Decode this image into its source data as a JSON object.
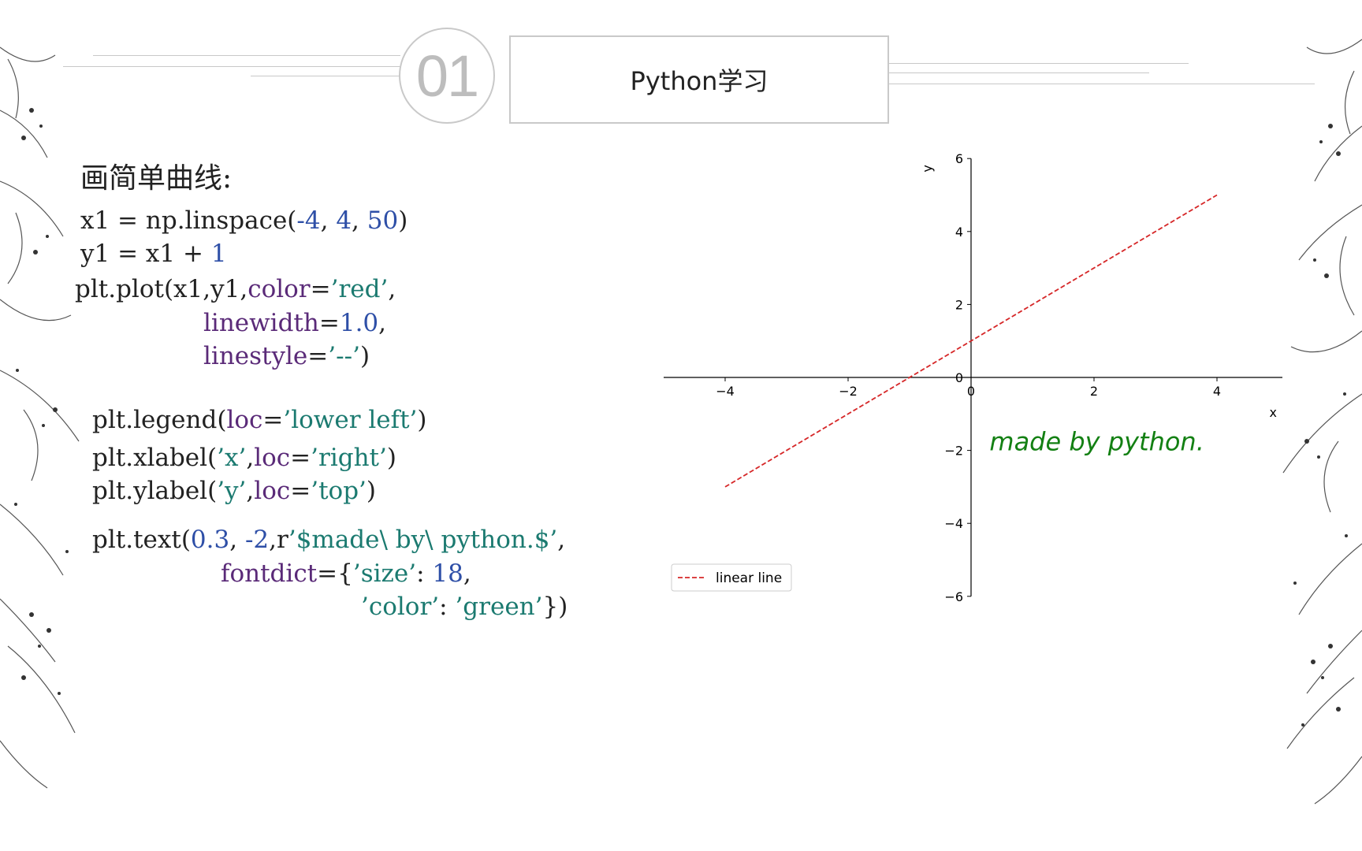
{
  "slide": {
    "section_number": "01",
    "title": "Python学习",
    "subtitle": "画简单曲线:"
  },
  "code": {
    "line1": {
      "a": "x1 = np.linspace(",
      "b": "-4",
      "c": ", ",
      "d": "4",
      "e": ", ",
      "f": "50",
      "g": ")"
    },
    "line2": {
      "a": "y1 = x1 + ",
      "b": "1"
    },
    "line3": {
      "a": "plt.plot(x1,y1,",
      "b": "color",
      "c": "=",
      "d": "’red’",
      "e": ","
    },
    "line4": {
      "a": "linewidth",
      "b": "=",
      "c": "1.0",
      "d": ","
    },
    "line5": {
      "a": "linestyle",
      "b": "=",
      "c": "’--’",
      "d": ")"
    },
    "line6": {
      "a": "plt.legend(",
      "b": "loc",
      "c": "=",
      "d": "’lower left’",
      "e": ")"
    },
    "line7": {
      "a": "plt.xlabel(",
      "b": "’x’",
      "c": ",",
      "d": "loc",
      "e": "=",
      "f": "’right’",
      "g": ")"
    },
    "line8": {
      "a": "plt.ylabel(",
      "b": "’y’",
      "c": ",",
      "d": "loc",
      "e": "=",
      "f": "’top’",
      "g": ")"
    },
    "line9": {
      "a": "plt.text(",
      "b": "0.3",
      "c": ", ",
      "d": "-2",
      "e": ",r",
      "f": "’$made\\ by\\ python.$’",
      "g": ","
    },
    "line10": {
      "a": "fontdict",
      "b": "={",
      "c": "’size’",
      "d": ": ",
      "e": "18",
      "f": ","
    },
    "line11": {
      "a": "’color’",
      "b": ": ",
      "c": "’green’",
      "d": "})"
    }
  },
  "colors": {
    "line": "#d62728",
    "annotation": "#138013",
    "code_number": "#2e4fa7",
    "code_keyword": "#5a2a78",
    "code_string": "#1b7a70"
  },
  "chart_data": {
    "type": "line",
    "x": [
      -4,
      4
    ],
    "series": [
      {
        "name": "linear line",
        "x": [
          -4,
          4
        ],
        "y": [
          -3,
          5
        ],
        "color": "#d62728",
        "linestyle": "dashed"
      }
    ],
    "xlabel": "x",
    "ylabel": "y",
    "xlim": [
      -5,
      5
    ],
    "ylim": [
      -6,
      6
    ],
    "xticks": [
      -4,
      -2,
      0,
      2,
      4
    ],
    "yticks": [
      -6,
      -4,
      -2,
      0,
      2,
      4,
      6
    ],
    "xtick_labels": [
      "−4",
      "−2",
      "0",
      "2",
      "4"
    ],
    "ytick_labels": [
      "−6",
      "−4",
      "−2",
      "0",
      "2",
      "4",
      "6"
    ],
    "annotation": {
      "text": "made by python.",
      "x": 0.3,
      "y": -2
    },
    "legend": {
      "position": "lower left"
    },
    "grid": false,
    "spines": "centered at origin"
  }
}
